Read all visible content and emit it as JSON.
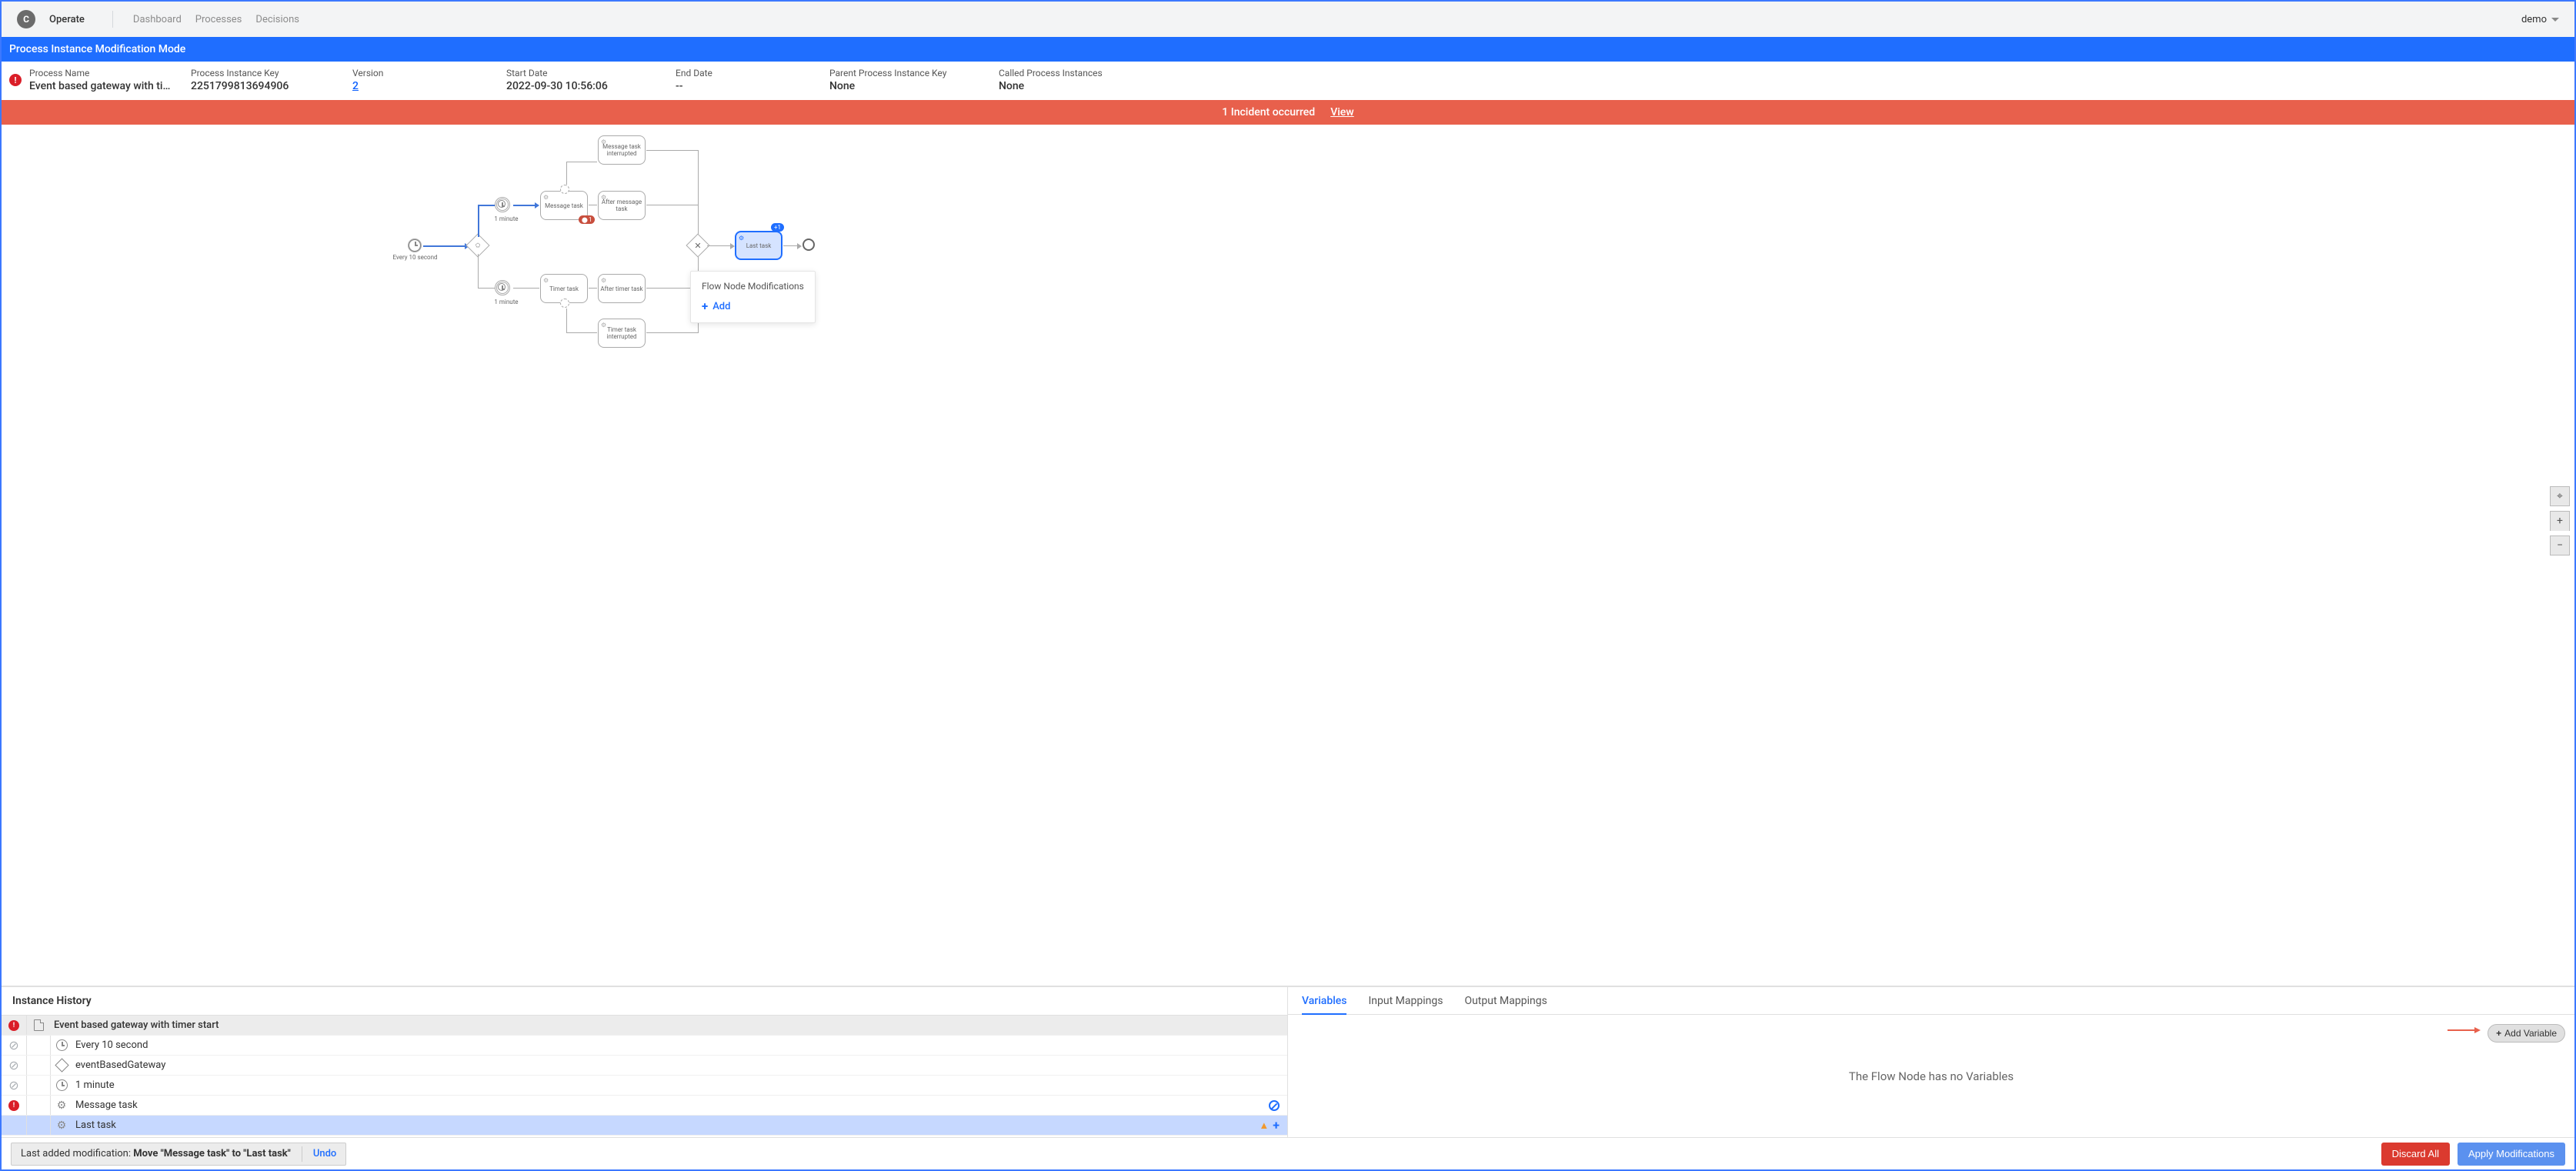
{
  "nav": {
    "logo_letter": "C",
    "app_name": "Operate",
    "links": [
      "Dashboard",
      "Processes",
      "Decisions"
    ],
    "user": "demo"
  },
  "mode_banner": "Process Instance Modification Mode",
  "summary": {
    "process_name": {
      "label": "Process Name",
      "value": "Event based gateway with timer..."
    },
    "process_instance_key": {
      "label": "Process Instance Key",
      "value": "2251799813694906"
    },
    "version": {
      "label": "Version",
      "value": "2"
    },
    "start_date": {
      "label": "Start Date",
      "value": "2022-09-30 10:56:06"
    },
    "end_date": {
      "label": "End Date",
      "value": "--"
    },
    "parent_key": {
      "label": "Parent Process Instance Key",
      "value": "None"
    },
    "called": {
      "label": "Called Process Instances",
      "value": "None"
    }
  },
  "incident": {
    "text": "1 Incident occurred",
    "link": "View"
  },
  "diagram": {
    "start_label": "Every 10 second",
    "timer1_label": "1 minute",
    "timer2_label": "1 minute",
    "tasks": {
      "msg": "Message task",
      "msg_int": "Message task interrupted",
      "after_msg": "After message task",
      "timer": "Timer task",
      "timer_int": "Timer task interrupted",
      "after_timer": "After timer task",
      "last": "Last task"
    },
    "badge_count": "1",
    "badge_add": "+1",
    "popover_title": "Flow Node Modifications",
    "popover_add": "Add"
  },
  "history": {
    "title": "Instance History",
    "rows": [
      {
        "status": "error",
        "icon": "doc",
        "label": "Event based gateway with timer start",
        "actions": [],
        "level": 0
      },
      {
        "status": "ok",
        "icon": "clock",
        "label": "Every 10 second",
        "actions": [],
        "level": 1
      },
      {
        "status": "ok",
        "icon": "diamond",
        "label": "eventBasedGateway",
        "actions": [],
        "level": 1
      },
      {
        "status": "ok",
        "icon": "clock",
        "label": "1 minute",
        "actions": [],
        "level": 1
      },
      {
        "status": "error",
        "icon": "gear",
        "label": "Message task",
        "actions": [
          "blocked"
        ],
        "level": 1
      },
      {
        "status": "none",
        "icon": "gear",
        "label": "Last task",
        "actions": [
          "warn",
          "plus"
        ],
        "level": 1,
        "selected": true
      }
    ]
  },
  "vars_panel": {
    "tabs": [
      "Variables",
      "Input Mappings",
      "Output Mappings"
    ],
    "active_tab": 0,
    "add_button": "Add Variable",
    "empty": "The Flow Node has no Variables"
  },
  "footer": {
    "last_modification_label": "Last added modification: ",
    "last_modification_value": "Move \"Message task\" to \"Last task\"",
    "undo": "Undo",
    "discard": "Discard All",
    "apply": "Apply Modifications"
  }
}
